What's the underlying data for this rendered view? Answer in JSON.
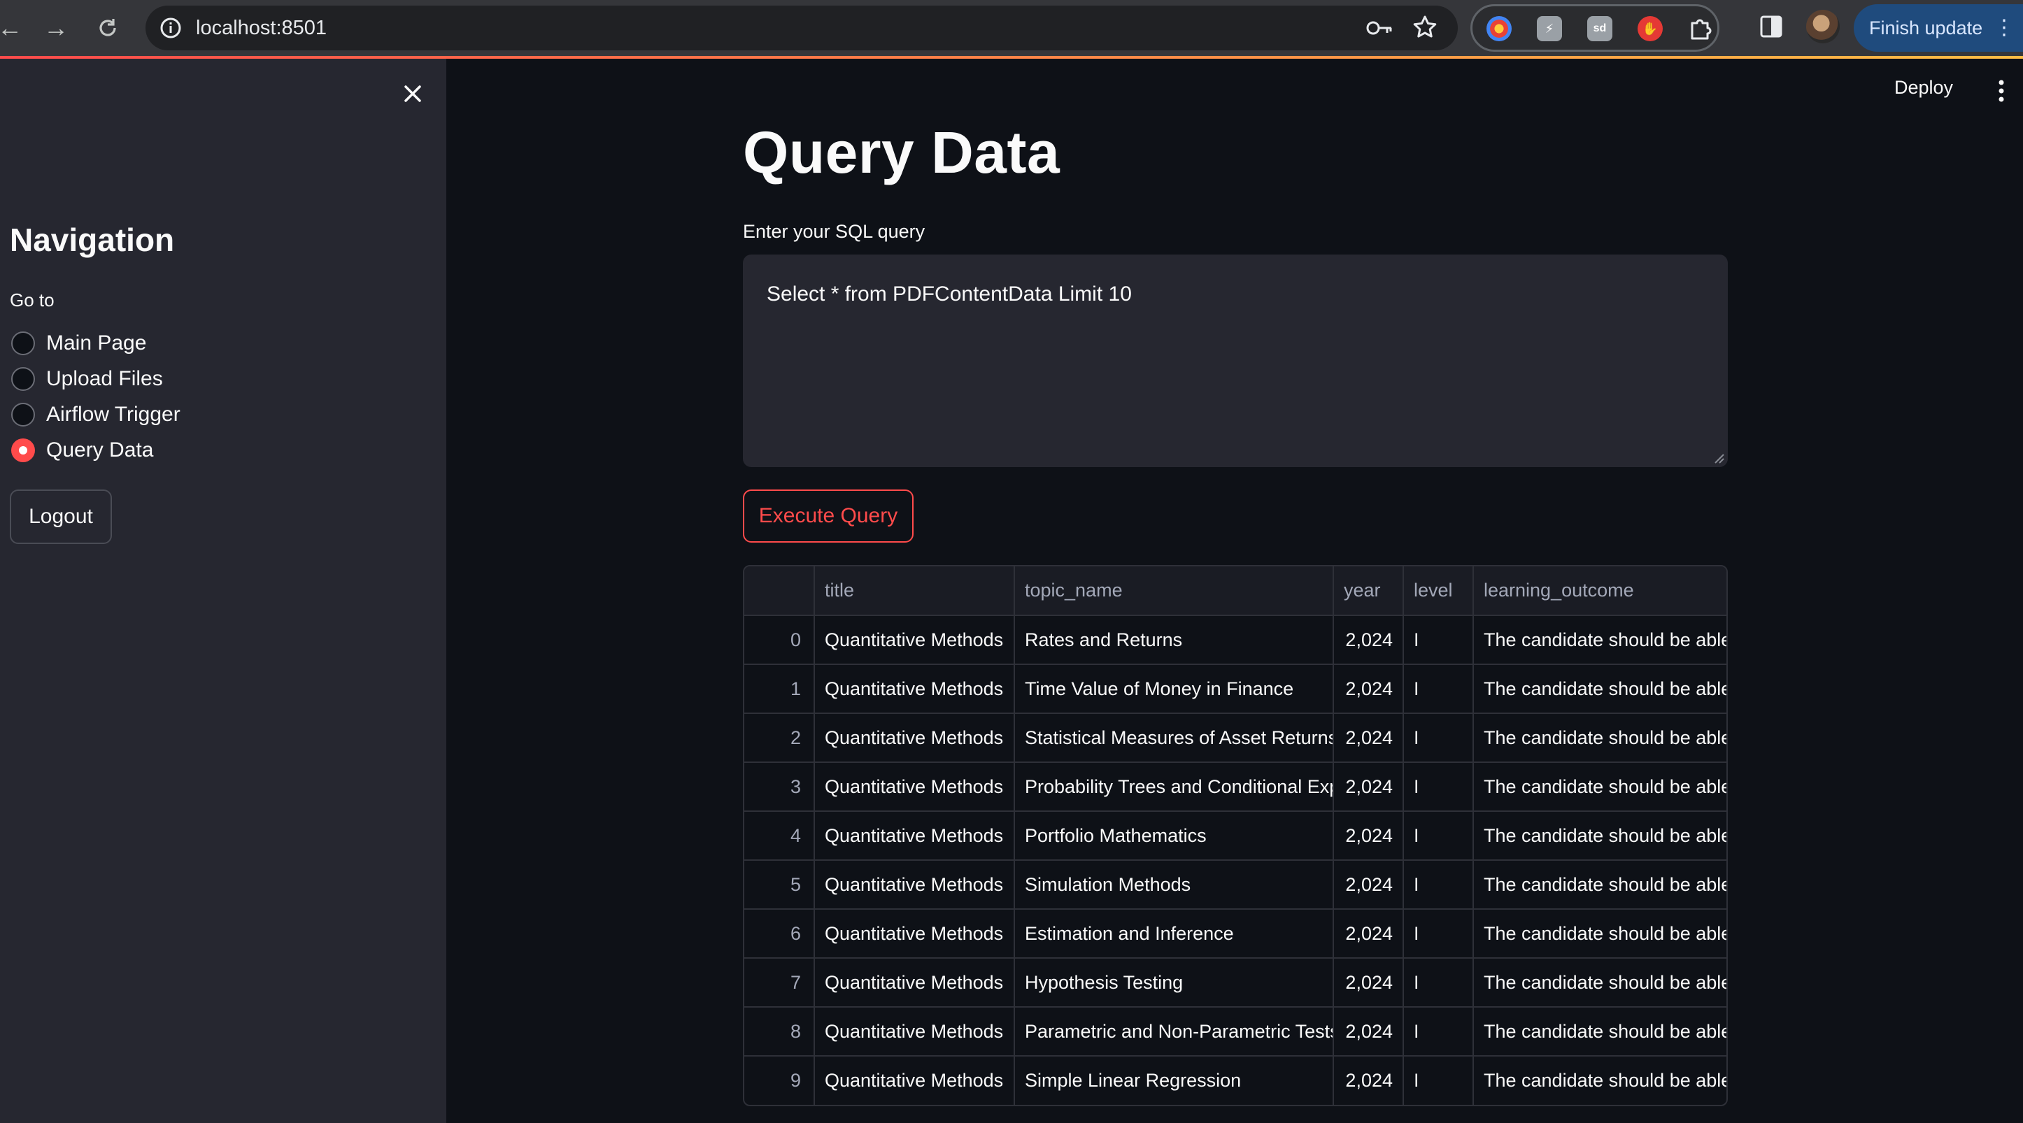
{
  "browser": {
    "url": "localhost:8501",
    "finish_update_label": "Finish update",
    "extensions": [
      "chromium-ext-icon",
      "note-ext-icon",
      "sd-ext-icon",
      "stop-ext-icon",
      "puzzle-icon"
    ]
  },
  "sidebar": {
    "title": "Navigation",
    "goto_label": "Go to",
    "options": [
      "Main Page",
      "Upload Files",
      "Airflow Trigger",
      "Query Data"
    ],
    "selected": "Query Data",
    "logout_label": "Logout"
  },
  "header": {
    "deploy_label": "Deploy"
  },
  "main": {
    "title": "Query Data",
    "query_label": "Enter your SQL query",
    "query_value": "Select * from PDFContentData Limit 10",
    "execute_label": "Execute Query"
  },
  "table": {
    "columns": [
      "",
      "title",
      "topic_name",
      "year",
      "level",
      "learning_outcome"
    ],
    "rows": [
      [
        "0",
        "Quantitative Methods",
        "Rates and Returns",
        "2,024",
        "I",
        "The candidate should be able"
      ],
      [
        "1",
        "Quantitative Methods",
        "Time Value of Money in Finance",
        "2,024",
        "I",
        "The candidate should be able"
      ],
      [
        "2",
        "Quantitative Methods",
        "Statistical Measures of Asset Returns",
        "2,024",
        "I",
        "The candidate should be able"
      ],
      [
        "3",
        "Quantitative Methods",
        "Probability Trees and Conditional Exp",
        "2,024",
        "I",
        "The candidate should be able"
      ],
      [
        "4",
        "Quantitative Methods",
        "Portfolio Mathematics",
        "2,024",
        "I",
        "The candidate should be able"
      ],
      [
        "5",
        "Quantitative Methods",
        "Simulation Methods",
        "2,024",
        "I",
        "The candidate should be able"
      ],
      [
        "6",
        "Quantitative Methods",
        "Estimation and Inference",
        "2,024",
        "I",
        "The candidate should be able"
      ],
      [
        "7",
        "Quantitative Methods",
        "Hypothesis Testing",
        "2,024",
        "I",
        "The candidate should be able"
      ],
      [
        "8",
        "Quantitative Methods",
        "Parametric and Non-Parametric Tests",
        "2,024",
        "I",
        "The candidate should be able"
      ],
      [
        "9",
        "Quantitative Methods",
        "Simple Linear Regression",
        "2,024",
        "I",
        "The candidate should be able"
      ]
    ]
  },
  "colors": {
    "accent": "#ff4b4b",
    "background": "#0e1117",
    "sidebar": "#262730"
  }
}
